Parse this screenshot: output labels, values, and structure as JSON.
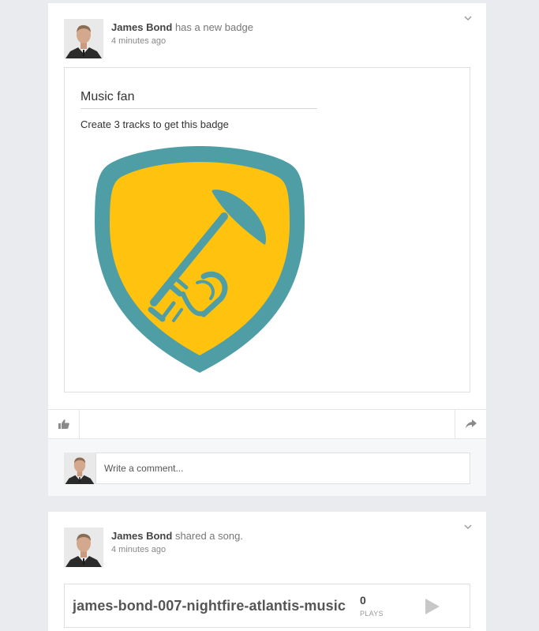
{
  "posts": [
    {
      "author": "James Bond",
      "action": "has a new badge",
      "time": "4 minutes ago",
      "badge": {
        "title": "Music fan",
        "description": "Create 3 tracks to get this badge",
        "colors": {
          "shield_outer": "#4f9ea6",
          "shield_inner": "#ffc20e",
          "instrument": "#4f9ea6"
        },
        "icon": "trumpet-shield-badge"
      },
      "comment": {
        "placeholder": "Write a comment..."
      }
    },
    {
      "author": "James Bond",
      "action": "shared a song.",
      "time": "4 minutes ago",
      "song": {
        "title": "james-bond-007-nightfire-atlantis-music",
        "plays": "0",
        "plays_label": "PLAYS"
      }
    }
  ],
  "icons": {
    "menu": "chevron-down-icon",
    "like": "thumbs-up-icon",
    "share": "share-arrow-icon",
    "play": "play-icon"
  }
}
